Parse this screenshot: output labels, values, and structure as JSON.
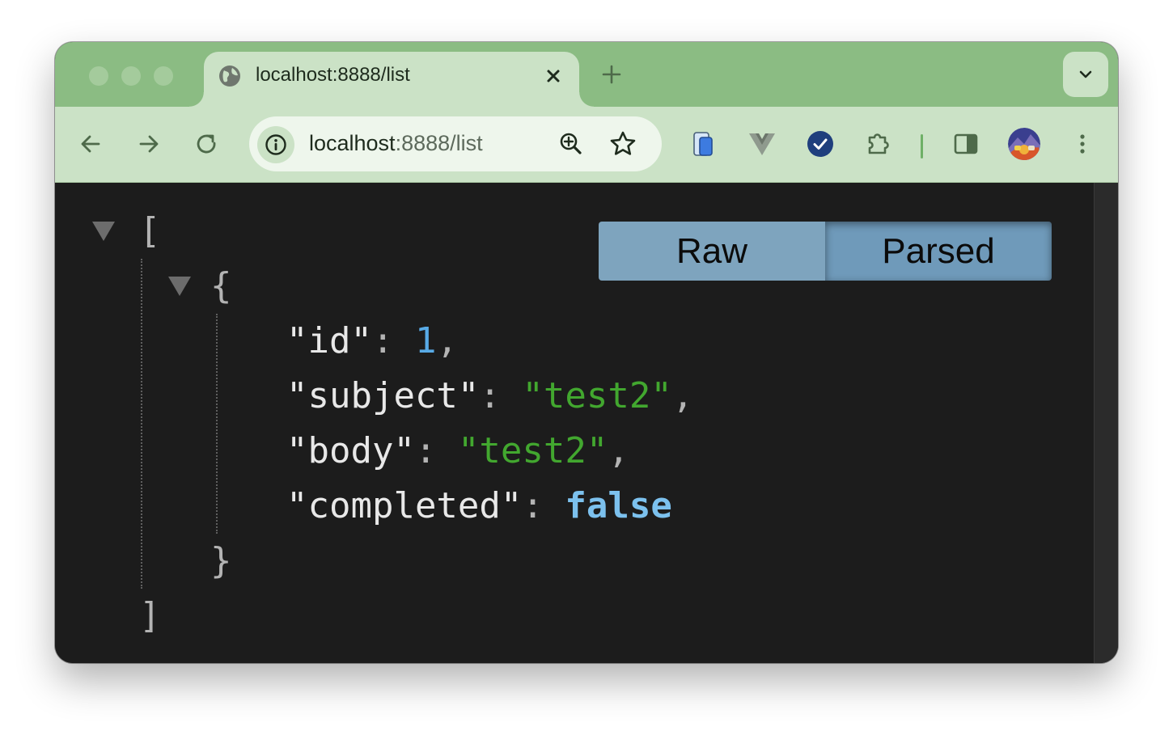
{
  "browser": {
    "tab": {
      "title": "localhost:8888/list",
      "icon": "globe-icon"
    },
    "url": {
      "host": "localhost",
      "path": ":8888/list"
    }
  },
  "viewer": {
    "toggle": {
      "raw_label": "Raw",
      "parsed_label": "Parsed",
      "active": "Parsed"
    },
    "brackets": {
      "array_open": "[",
      "array_close": "]",
      "object_open": "{",
      "object_close": "}"
    },
    "fields": [
      {
        "key": "\"id\"",
        "value": "1",
        "type": "number",
        "trail": ","
      },
      {
        "key": "\"subject\"",
        "value": "\"test2\"",
        "type": "string",
        "trail": ","
      },
      {
        "key": "\"body\"",
        "value": "\"test2\"",
        "type": "string",
        "trail": ","
      },
      {
        "key": "\"completed\"",
        "value": "false",
        "type": "boolean",
        "trail": ""
      }
    ],
    "colors": {
      "number": "#58aae6",
      "string": "#42a72f",
      "boolean": "#7cc1ee",
      "key": "#e8e8e8"
    }
  }
}
